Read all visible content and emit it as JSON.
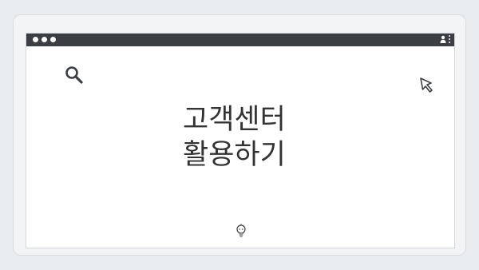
{
  "window": {
    "title_lines": [
      "고객센터",
      "활용하기"
    ]
  },
  "icons": {
    "search": "search-icon",
    "cursor": "cursor-arrow-icon",
    "idea": "lightbulb-icon",
    "user": "user-icon",
    "menu": "kebab-menu-icon"
  },
  "colors": {
    "background": "#e9ecef",
    "titlebar": "#3b3f44",
    "text": "#333333"
  }
}
